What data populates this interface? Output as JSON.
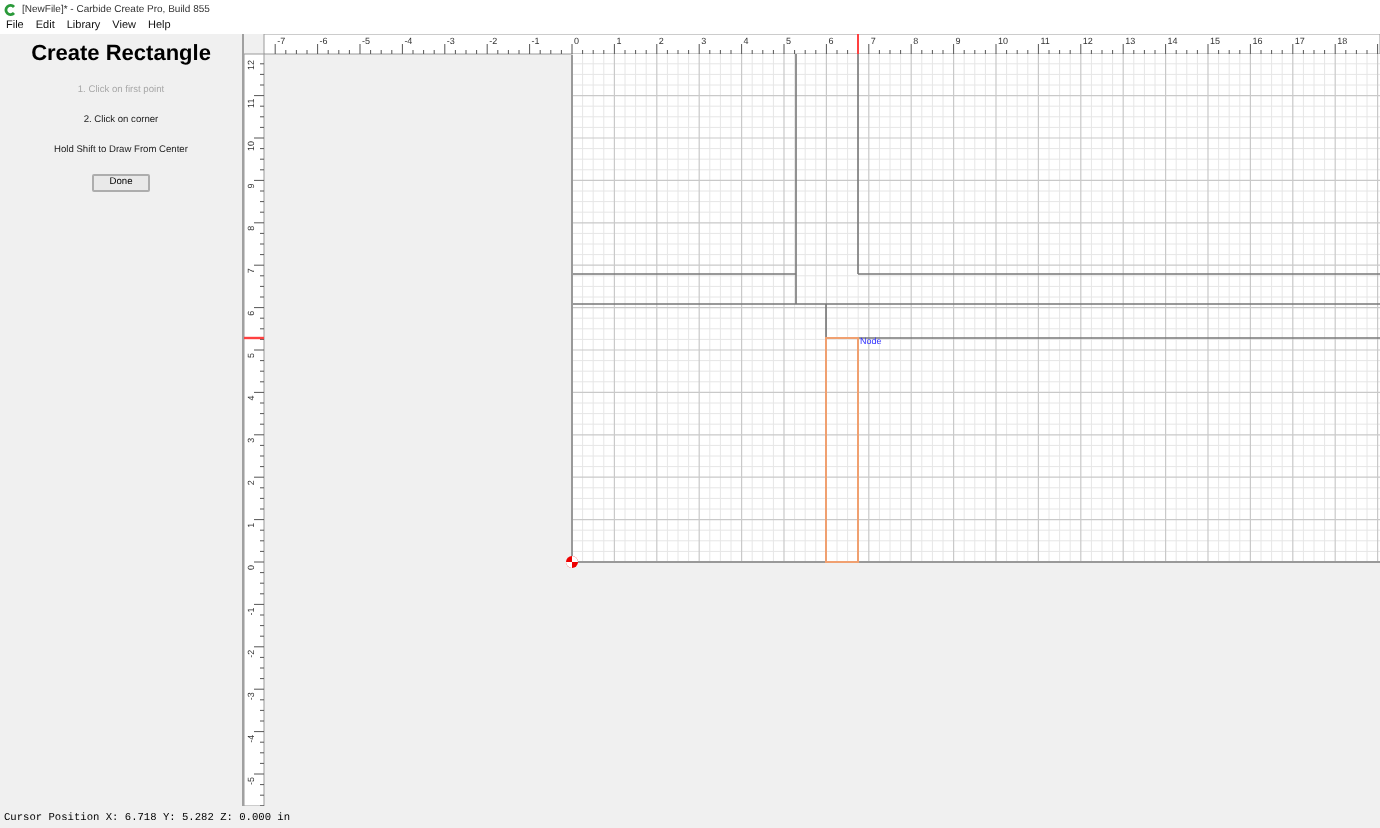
{
  "window": {
    "title": "[NewFile]* - Carbide Create Pro, Build 855"
  },
  "menu": [
    "File",
    "Edit",
    "Library",
    "View",
    "Help"
  ],
  "panel": {
    "title": "Create Rectangle",
    "steps": [
      {
        "text": "1. Click on first point",
        "disabled": true
      },
      {
        "text": "2. Click on corner",
        "disabled": false
      }
    ],
    "hint": "Hold Shift to Draw From Center",
    "button": "Done"
  },
  "canvas": {
    "x_ruler": [
      "-7",
      "-6",
      "-5",
      "-4",
      "-3",
      "-2",
      "-1",
      "0",
      "1",
      "2",
      "3",
      "4",
      "5",
      "6",
      "7",
      "8",
      "9",
      "10",
      "11",
      "12",
      "13",
      "14",
      "15",
      "16",
      "17",
      "18"
    ],
    "y_ruler": [
      "12",
      "11",
      "10",
      "9",
      "8",
      "7",
      "6",
      "5",
      "4",
      "3",
      "2",
      "1",
      "0",
      "-1",
      "-2",
      "-3",
      "-4",
      "-5"
    ],
    "node_label": "Node"
  },
  "status_bar": "Cursor Position X: 6.718 Y: 5.282 Z: 0.000 in"
}
